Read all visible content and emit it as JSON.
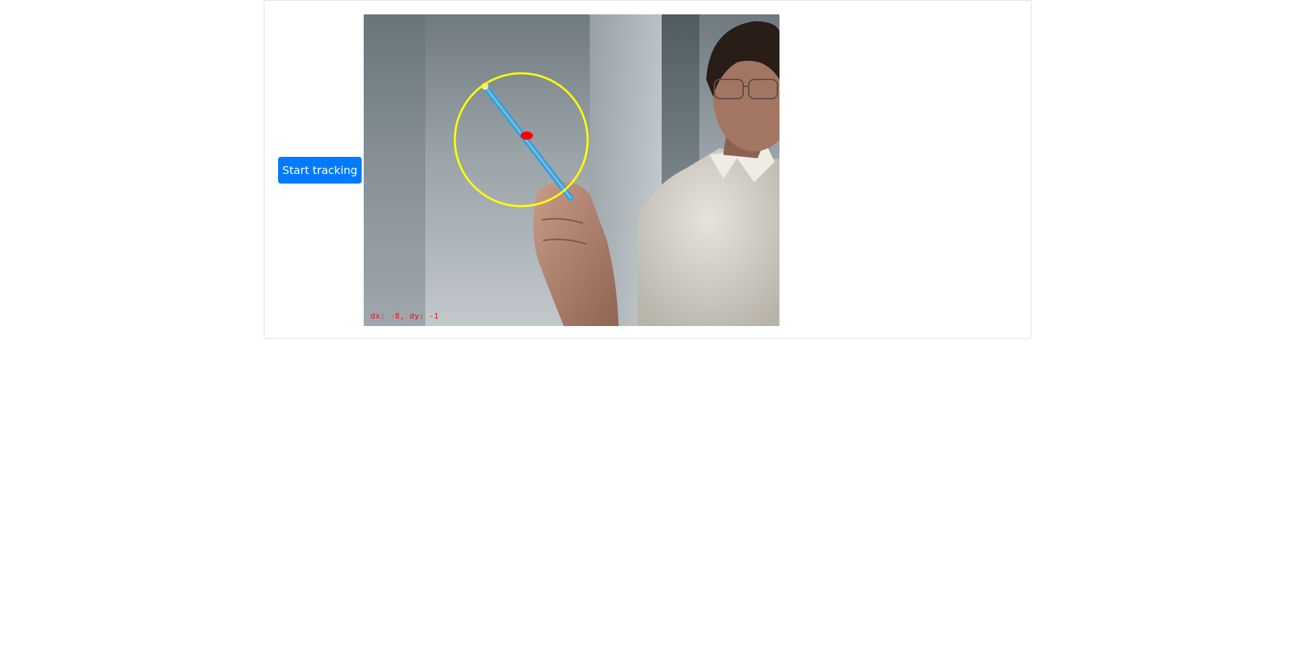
{
  "controls": {
    "start_label": "Start tracking"
  },
  "feed": {
    "overlay_text": "dx: -8, dy: -1",
    "tracking_circle_color": "#ffff00",
    "tracked_point_color": "#ff0000",
    "tracked_object_color": "#3a9fd8"
  }
}
